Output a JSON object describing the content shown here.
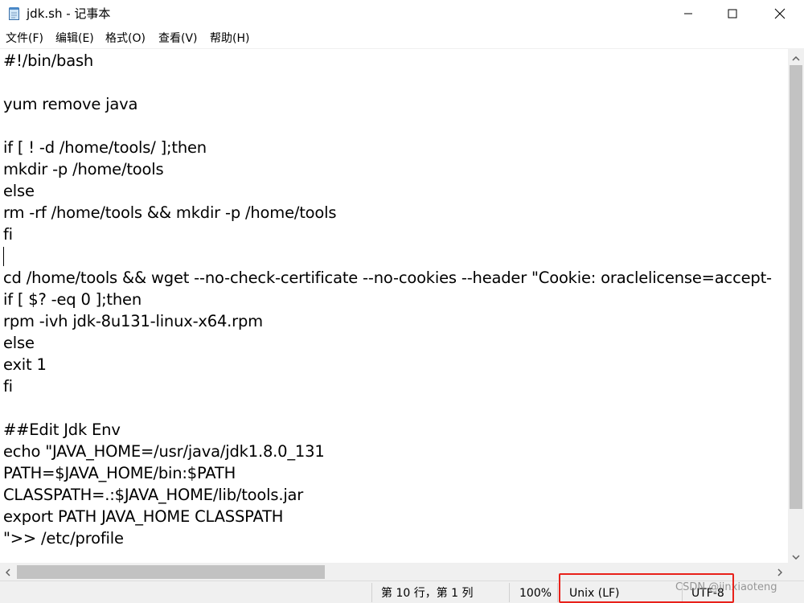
{
  "window": {
    "title": "jdk.sh - 记事本",
    "icon": "notepad-icon",
    "controls": {
      "minimize": "minimize-icon",
      "maximize": "maximize-icon",
      "close": "close-icon"
    }
  },
  "menu": [
    "文件(F)",
    "编辑(E)",
    "格式(O)",
    "查看(V)",
    "帮助(H)"
  ],
  "editor": {
    "lines": [
      "#!/bin/bash",
      "",
      "yum remove java",
      "",
      "if [ ! -d /home/tools/ ];then",
      "mkdir -p /home/tools",
      "else",
      "rm -rf /home/tools && mkdir -p /home/tools",
      "fi",
      "",
      "cd /home/tools && wget --no-check-certificate --no-cookies --header \"Cookie: oraclelicense=accept-",
      "if [ $? -eq 0 ];then",
      "rpm -ivh jdk-8u131-linux-x64.rpm",
      "else",
      "exit 1",
      "fi",
      "",
      "",
      "##Edit Jdk Env",
      "echo \"JAVA_HOME=/usr/java/jdk1.8.0_131",
      "PATH=$JAVA_HOME/bin:$PATH",
      "CLASSPATH=.:$JAVA_HOME/lib/tools.jar",
      "export PATH JAVA_HOME CLASSPATH",
      "\">> /etc/profile"
    ]
  },
  "status": {
    "position": "第 10 行，第 1 列",
    "zoom": "100%",
    "line_ending": "Unix (LF)",
    "encoding": "UTF-8"
  },
  "watermark": "CSDN @jinxiaoteng",
  "colors": {
    "highlight": "#e8211a",
    "scroll_thumb": "#c2c2c2",
    "chrome": "#f0f0f0"
  }
}
